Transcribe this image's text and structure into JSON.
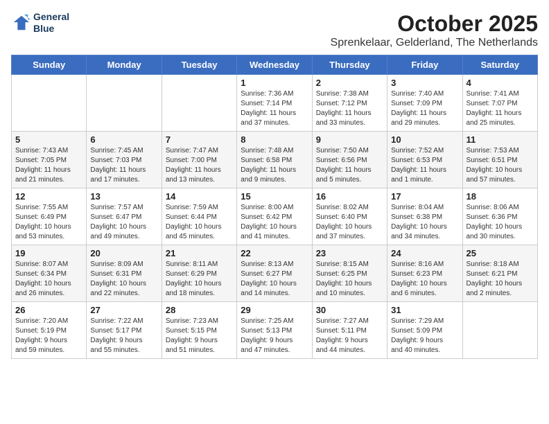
{
  "logo": {
    "line1": "General",
    "line2": "Blue"
  },
  "header": {
    "month": "October 2025",
    "location": "Sprenkelaar, Gelderland, The Netherlands"
  },
  "weekdays": [
    "Sunday",
    "Monday",
    "Tuesday",
    "Wednesday",
    "Thursday",
    "Friday",
    "Saturday"
  ],
  "weeks": [
    [
      {
        "day": "",
        "info": ""
      },
      {
        "day": "",
        "info": ""
      },
      {
        "day": "",
        "info": ""
      },
      {
        "day": "1",
        "info": "Sunrise: 7:36 AM\nSunset: 7:14 PM\nDaylight: 11 hours\nand 37 minutes."
      },
      {
        "day": "2",
        "info": "Sunrise: 7:38 AM\nSunset: 7:12 PM\nDaylight: 11 hours\nand 33 minutes."
      },
      {
        "day": "3",
        "info": "Sunrise: 7:40 AM\nSunset: 7:09 PM\nDaylight: 11 hours\nand 29 minutes."
      },
      {
        "day": "4",
        "info": "Sunrise: 7:41 AM\nSunset: 7:07 PM\nDaylight: 11 hours\nand 25 minutes."
      }
    ],
    [
      {
        "day": "5",
        "info": "Sunrise: 7:43 AM\nSunset: 7:05 PM\nDaylight: 11 hours\nand 21 minutes."
      },
      {
        "day": "6",
        "info": "Sunrise: 7:45 AM\nSunset: 7:03 PM\nDaylight: 11 hours\nand 17 minutes."
      },
      {
        "day": "7",
        "info": "Sunrise: 7:47 AM\nSunset: 7:00 PM\nDaylight: 11 hours\nand 13 minutes."
      },
      {
        "day": "8",
        "info": "Sunrise: 7:48 AM\nSunset: 6:58 PM\nDaylight: 11 hours\nand 9 minutes."
      },
      {
        "day": "9",
        "info": "Sunrise: 7:50 AM\nSunset: 6:56 PM\nDaylight: 11 hours\nand 5 minutes."
      },
      {
        "day": "10",
        "info": "Sunrise: 7:52 AM\nSunset: 6:53 PM\nDaylight: 11 hours\nand 1 minute."
      },
      {
        "day": "11",
        "info": "Sunrise: 7:53 AM\nSunset: 6:51 PM\nDaylight: 10 hours\nand 57 minutes."
      }
    ],
    [
      {
        "day": "12",
        "info": "Sunrise: 7:55 AM\nSunset: 6:49 PM\nDaylight: 10 hours\nand 53 minutes."
      },
      {
        "day": "13",
        "info": "Sunrise: 7:57 AM\nSunset: 6:47 PM\nDaylight: 10 hours\nand 49 minutes."
      },
      {
        "day": "14",
        "info": "Sunrise: 7:59 AM\nSunset: 6:44 PM\nDaylight: 10 hours\nand 45 minutes."
      },
      {
        "day": "15",
        "info": "Sunrise: 8:00 AM\nSunset: 6:42 PM\nDaylight: 10 hours\nand 41 minutes."
      },
      {
        "day": "16",
        "info": "Sunrise: 8:02 AM\nSunset: 6:40 PM\nDaylight: 10 hours\nand 37 minutes."
      },
      {
        "day": "17",
        "info": "Sunrise: 8:04 AM\nSunset: 6:38 PM\nDaylight: 10 hours\nand 34 minutes."
      },
      {
        "day": "18",
        "info": "Sunrise: 8:06 AM\nSunset: 6:36 PM\nDaylight: 10 hours\nand 30 minutes."
      }
    ],
    [
      {
        "day": "19",
        "info": "Sunrise: 8:07 AM\nSunset: 6:34 PM\nDaylight: 10 hours\nand 26 minutes."
      },
      {
        "day": "20",
        "info": "Sunrise: 8:09 AM\nSunset: 6:31 PM\nDaylight: 10 hours\nand 22 minutes."
      },
      {
        "day": "21",
        "info": "Sunrise: 8:11 AM\nSunset: 6:29 PM\nDaylight: 10 hours\nand 18 minutes."
      },
      {
        "day": "22",
        "info": "Sunrise: 8:13 AM\nSunset: 6:27 PM\nDaylight: 10 hours\nand 14 minutes."
      },
      {
        "day": "23",
        "info": "Sunrise: 8:15 AM\nSunset: 6:25 PM\nDaylight: 10 hours\nand 10 minutes."
      },
      {
        "day": "24",
        "info": "Sunrise: 8:16 AM\nSunset: 6:23 PM\nDaylight: 10 hours\nand 6 minutes."
      },
      {
        "day": "25",
        "info": "Sunrise: 8:18 AM\nSunset: 6:21 PM\nDaylight: 10 hours\nand 2 minutes."
      }
    ],
    [
      {
        "day": "26",
        "info": "Sunrise: 7:20 AM\nSunset: 5:19 PM\nDaylight: 9 hours\nand 59 minutes."
      },
      {
        "day": "27",
        "info": "Sunrise: 7:22 AM\nSunset: 5:17 PM\nDaylight: 9 hours\nand 55 minutes."
      },
      {
        "day": "28",
        "info": "Sunrise: 7:23 AM\nSunset: 5:15 PM\nDaylight: 9 hours\nand 51 minutes."
      },
      {
        "day": "29",
        "info": "Sunrise: 7:25 AM\nSunset: 5:13 PM\nDaylight: 9 hours\nand 47 minutes."
      },
      {
        "day": "30",
        "info": "Sunrise: 7:27 AM\nSunset: 5:11 PM\nDaylight: 9 hours\nand 44 minutes."
      },
      {
        "day": "31",
        "info": "Sunrise: 7:29 AM\nSunset: 5:09 PM\nDaylight: 9 hours\nand 40 minutes."
      },
      {
        "day": "",
        "info": ""
      }
    ]
  ]
}
